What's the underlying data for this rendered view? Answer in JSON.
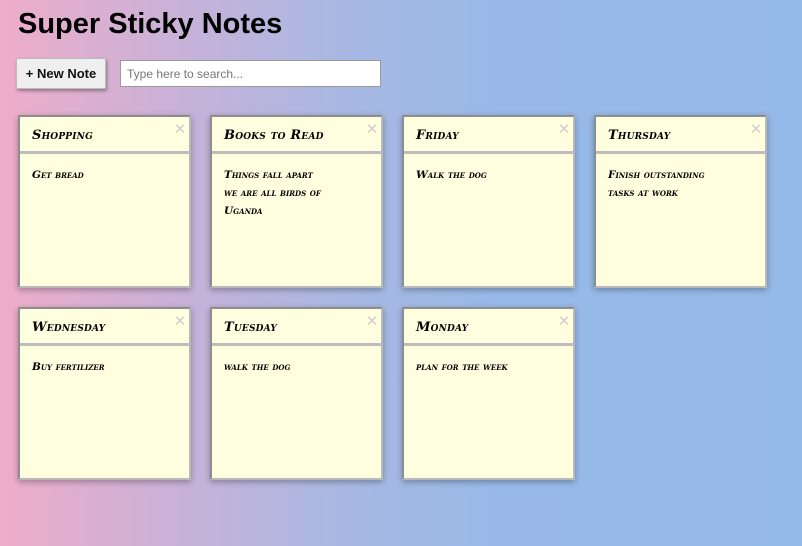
{
  "app": {
    "title": "Super Sticky Notes"
  },
  "toolbar": {
    "new_note_label": "+ New Note",
    "search_placeholder": "Type here to search...",
    "search_value": ""
  },
  "notes": [
    {
      "title": "Shopping",
      "body": "Get bread",
      "delete_glyph": "✕"
    },
    {
      "title": "Books to Read",
      "body": "Things fall apart\nwe are all birds of\nUganda",
      "delete_glyph": "✕"
    },
    {
      "title": "Friday",
      "body": "Walk the dog",
      "delete_glyph": "✕"
    },
    {
      "title": "Thursday",
      "body": "Finish outstanding\ntasks at work",
      "delete_glyph": "✕"
    },
    {
      "title": "Wednesday",
      "body": "Buy fertilizer",
      "delete_glyph": "✕"
    },
    {
      "title": "Tuesday",
      "body": "walk the dog",
      "delete_glyph": "✕"
    },
    {
      "title": "Monday",
      "body": "plan for the week",
      "delete_glyph": "✕"
    }
  ],
  "colors": {
    "note_background": "#ffffdf",
    "gradient_left": "#eeadc9",
    "gradient_right": "#95b9e9"
  }
}
